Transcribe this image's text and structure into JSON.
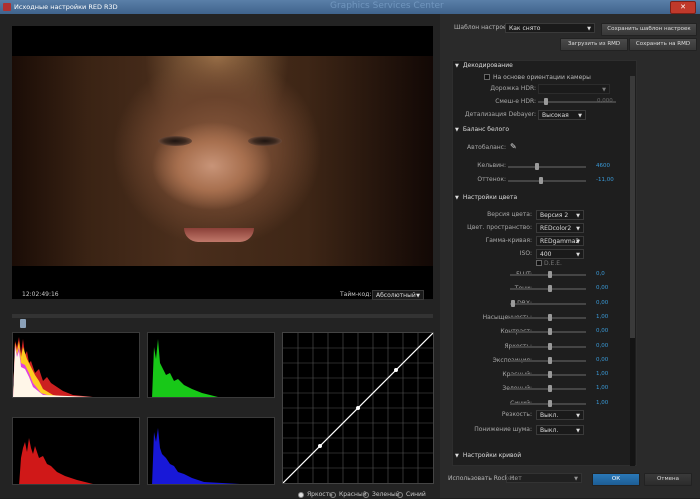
{
  "window": {
    "title": "Исходные настройки RED R3D",
    "ghost": "Graphics Services Center"
  },
  "preview": {
    "timecode": "12:02:49:16",
    "timecode_label": "Тайм-код:",
    "timecode_mode": "Абсолютный",
    "curve_channels": [
      "Яркость",
      "Красный",
      "Зеленый",
      "Синий"
    ],
    "selected_channel": "Яркость"
  },
  "preset": {
    "label": "Шаблон настроек:",
    "value": "Как снято",
    "save_template": "Сохранить шаблон настроек",
    "load_rmd": "Загрузить из RMD",
    "save_rmd": "Сохранить на RMD"
  },
  "decoding": {
    "section": "Декодирование",
    "camera_orient": "На основе ориентации камеры",
    "hdr_track_label": "Дорожка HDR:",
    "hdr_mix_label": "Смеш-е HDR:",
    "hdr_mix_value": "0,000",
    "debayer_label": "Детализация Debayer:",
    "debayer_value": "Высокая"
  },
  "white_balance": {
    "section": "Баланс белого",
    "auto_label": "Автобаланс:",
    "kelvin_label": "Кельвин:",
    "kelvin_value": "4600",
    "tint_label": "Оттенок:",
    "tint_value": "-11,00"
  },
  "color": {
    "section": "Настройки цвета",
    "version_label": "Версия цвета:",
    "version_value": "Версия 2",
    "space_label": "Цвет. пространство:",
    "space_value": "REDcolor2",
    "gamma_label": "Гамма-кривая:",
    "gamma_value": "REDgamma2",
    "iso_label": "ISO:",
    "iso_value": "400",
    "dee_label": "D.E.E.",
    "sliders": [
      {
        "label": "FLUT:",
        "value": "0,0"
      },
      {
        "label": "Тени:",
        "value": "0,00"
      },
      {
        "label": "DRX:",
        "value": "0,00"
      },
      {
        "label": "Насыщенность:",
        "value": "1,00"
      },
      {
        "label": "Контраст:",
        "value": "0,00"
      },
      {
        "label": "Яркость:",
        "value": "0,00"
      },
      {
        "label": "Экспозиция:",
        "value": "0,00"
      },
      {
        "label": "Красный:",
        "value": "1,00"
      },
      {
        "label": "Зеленый:",
        "value": "1,00"
      },
      {
        "label": "Синий:",
        "value": "1,00"
      }
    ],
    "sharpness_label": "Резкость:",
    "sharpness_value": "Выкл.",
    "noise_label": "Понижение шума:",
    "noise_value": "Выкл."
  },
  "curve_section": {
    "section": "Настройки кривой"
  },
  "footer": {
    "rocket_label": "Использовать Rocket:",
    "rocket_value": "Нет",
    "ok": "ОК",
    "cancel": "Отмена"
  },
  "colors": {
    "accent": "#3a9ad8",
    "ok_button": "#2a78b8",
    "titlebar": "#4a6f98"
  }
}
